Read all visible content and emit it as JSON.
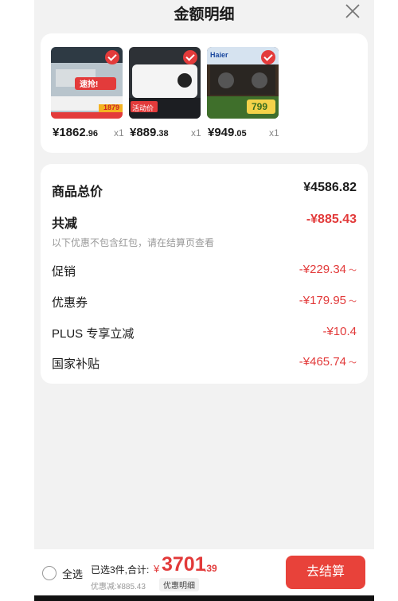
{
  "header": {
    "title": "金额明细"
  },
  "products": [
    {
      "price_main": "¥1862",
      "price_cents": ".96",
      "qty": "x1",
      "badge": "速抢!",
      "sub": "1879"
    },
    {
      "price_main": "¥889",
      "price_cents": ".38",
      "qty": "x1",
      "badge": "活动价"
    },
    {
      "price_main": "¥949",
      "price_cents": ".05",
      "qty": "x1",
      "brand": "Haier",
      "sub": "799"
    }
  ],
  "summary": {
    "total_label": "商品总价",
    "total_value": "¥4586.82",
    "discount_label": "共减",
    "discount_value": "-¥885.43",
    "note": "以下优惠不包含红包，请在结算页查看",
    "items": [
      {
        "label": "促销",
        "value": "-¥229.34"
      },
      {
        "label": "优惠券",
        "value": "-¥179.95"
      },
      {
        "label": "PLUS 专享立减",
        "value": "-¥10.4"
      },
      {
        "label": "国家补贴",
        "value": "-¥465.74"
      }
    ]
  },
  "footer": {
    "select_all": "全选",
    "selected_info": "已选3件,合计:",
    "currency": "¥",
    "total_int": "3701",
    "total_dec": ".39",
    "discount_text": "优惠减:¥885.43",
    "detail_button": "优惠明细",
    "checkout_button": "去结算"
  },
  "colors": {
    "accent": "#e8423a",
    "price_red": "#e23a3a",
    "background": "#f2f2f2"
  }
}
